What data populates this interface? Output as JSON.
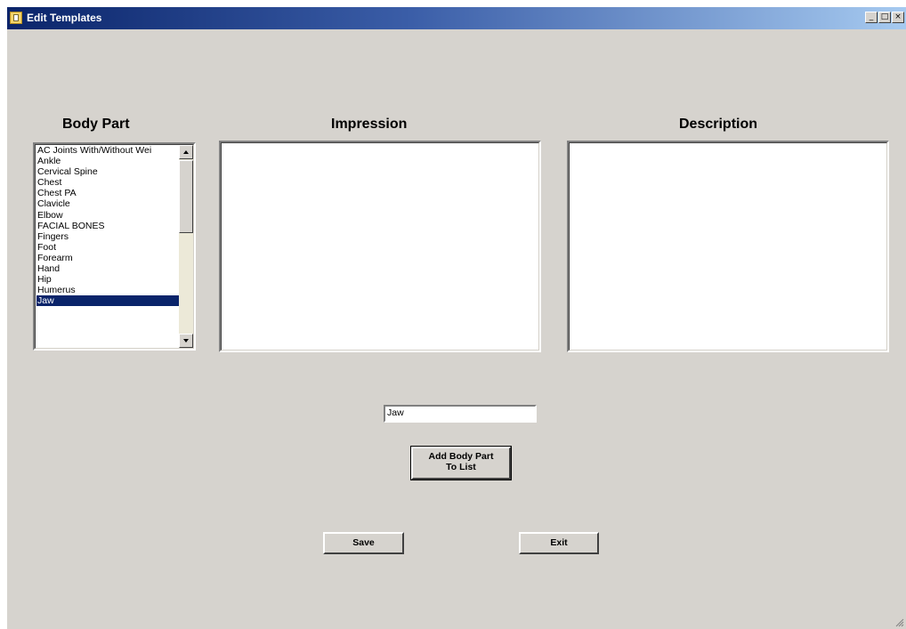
{
  "window": {
    "title": "Edit Templates",
    "controls": {
      "minimize": "_",
      "maximize": "□",
      "close": "×"
    }
  },
  "labels": {
    "body_part": "Body Part",
    "impression": "Impression",
    "description": "Description"
  },
  "body_parts": {
    "items": [
      "AC Joints With/Without Wei",
      "Ankle",
      "Cervical Spine",
      "Chest",
      "Chest PA",
      "Clavicle",
      "Elbow",
      "FACIAL BONES",
      "Fingers",
      "Foot",
      "Forearm",
      "Hand",
      "Hip",
      "Humerus",
      "Jaw"
    ],
    "selected": "Jaw"
  },
  "impression_text": "",
  "description_text": "",
  "new_body_part": {
    "value": "Jaw"
  },
  "buttons": {
    "add_line1": "Add Body Part",
    "add_line2": "To List",
    "save": "Save",
    "exit": "Exit"
  },
  "colors": {
    "window_bg": "#d6d3ce",
    "titlebar_start": "#0a246a",
    "titlebar_end": "#a6caf0",
    "selection": "#0a246a"
  }
}
